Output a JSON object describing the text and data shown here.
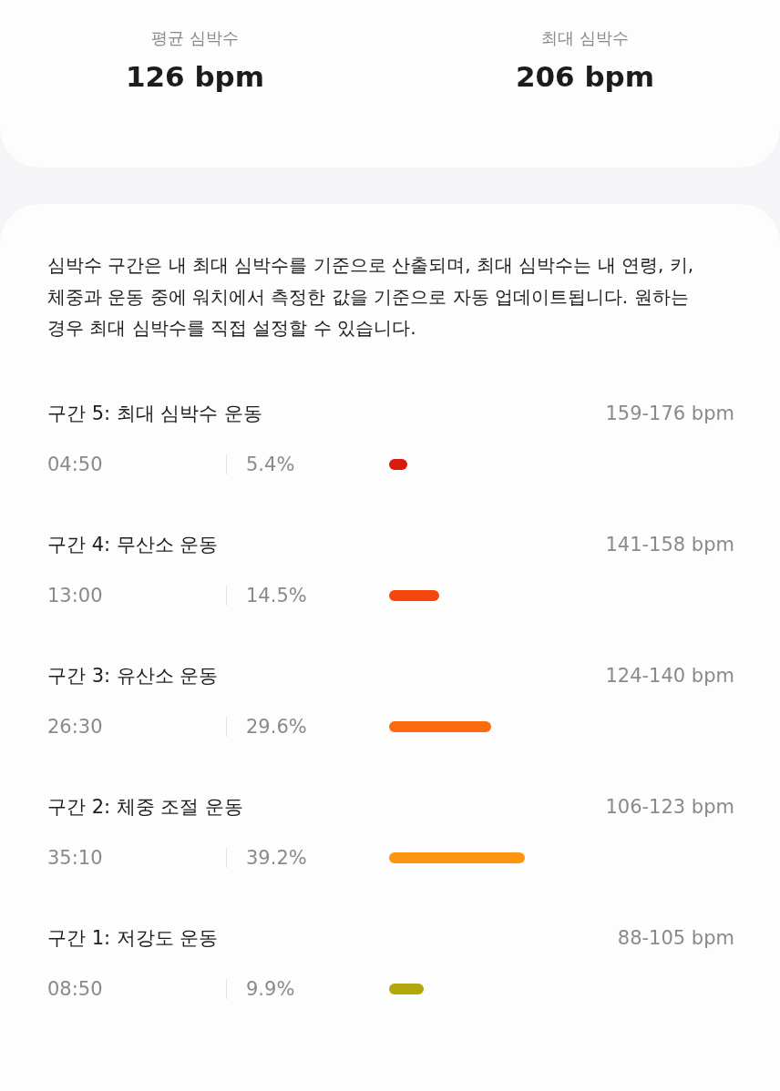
{
  "summary": [
    {
      "label": "평균 심박수",
      "value": "126 bpm"
    },
    {
      "label": "최대 심박수",
      "value": "206 bpm"
    }
  ],
  "description": "심박수 구간은 내 최대 심박수를 기준으로 산출되며, 최대 심박수는 내 연령, 키, 체중과 운동 중에 워치에서 측정한 값을 기준으로 자동 업데이트됩니다. 원하는 경우 최대 심박수를 직접 설정할 수 있습니다.",
  "zones": [
    {
      "name": "구간 5: 최대 심박수 운동",
      "range": "159-176 bpm",
      "time": "04:50",
      "percent": "5.4%",
      "color": "#d81b0c"
    },
    {
      "name": "구간 4: 무산소 운동",
      "range": "141-158 bpm",
      "time": "13:00",
      "percent": "14.5%",
      "color": "#f4470c"
    },
    {
      "name": "구간 3: 유산소 운동",
      "range": "124-140 bpm",
      "time": "26:30",
      "percent": "29.6%",
      "color": "#fb6c10"
    },
    {
      "name": "구간 2: 체중 조절 운동",
      "range": "106-123 bpm",
      "time": "35:10",
      "percent": "39.2%",
      "color": "#fd9510"
    },
    {
      "name": "구간 1: 저강도 운동",
      "range": "88-105 bpm",
      "time": "08:50",
      "percent": "9.9%",
      "color": "#b3a70e"
    }
  ]
}
